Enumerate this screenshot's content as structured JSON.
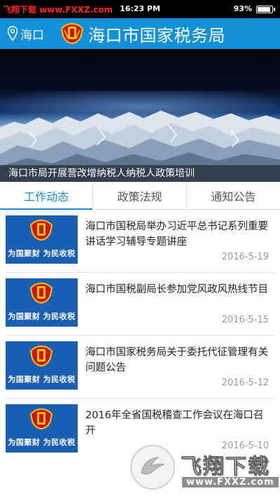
{
  "status_bar": {
    "watermark": "飞翔下载 www.FXXZ.com",
    "time": "16:23 PM",
    "battery_percent": "93%",
    "battery_level": 0.93
  },
  "header": {
    "location": "海口",
    "location_icon": "location-pin-icon",
    "emblem_icon": "tax-emblem-icon",
    "title": "海口市国家税务局",
    "color": "#1490d8"
  },
  "banner": {
    "caption": "海口市局开展营改增纳税人纳税人政策培训"
  },
  "tabs": [
    {
      "label": "工作动态",
      "active": true
    },
    {
      "label": "政策法规",
      "active": false
    },
    {
      "label": "通知公告",
      "active": false
    }
  ],
  "accent_color": "#1c8ad6",
  "thumb_slogan": "为国聚财  为民收税",
  "news": [
    {
      "title": "海口市国税局举办习近平总书记系列重要讲话学习辅导专题讲座",
      "date": "2016-5-19"
    },
    {
      "title": "海口市国税副局长参加党风政风热线节目",
      "date": "2016-5-15"
    },
    {
      "title": "海口市国家税务局关于委托代征管理有关问题公告",
      "date": "2016-5-12"
    },
    {
      "title": "2016年全省国税稽查工作会议在海口召开",
      "date": "2016-5-10"
    }
  ],
  "watermark_overlay": {
    "title": "飞翔下载",
    "url": "www.FXXZ.com",
    "icon": "bird-logo-icon"
  }
}
